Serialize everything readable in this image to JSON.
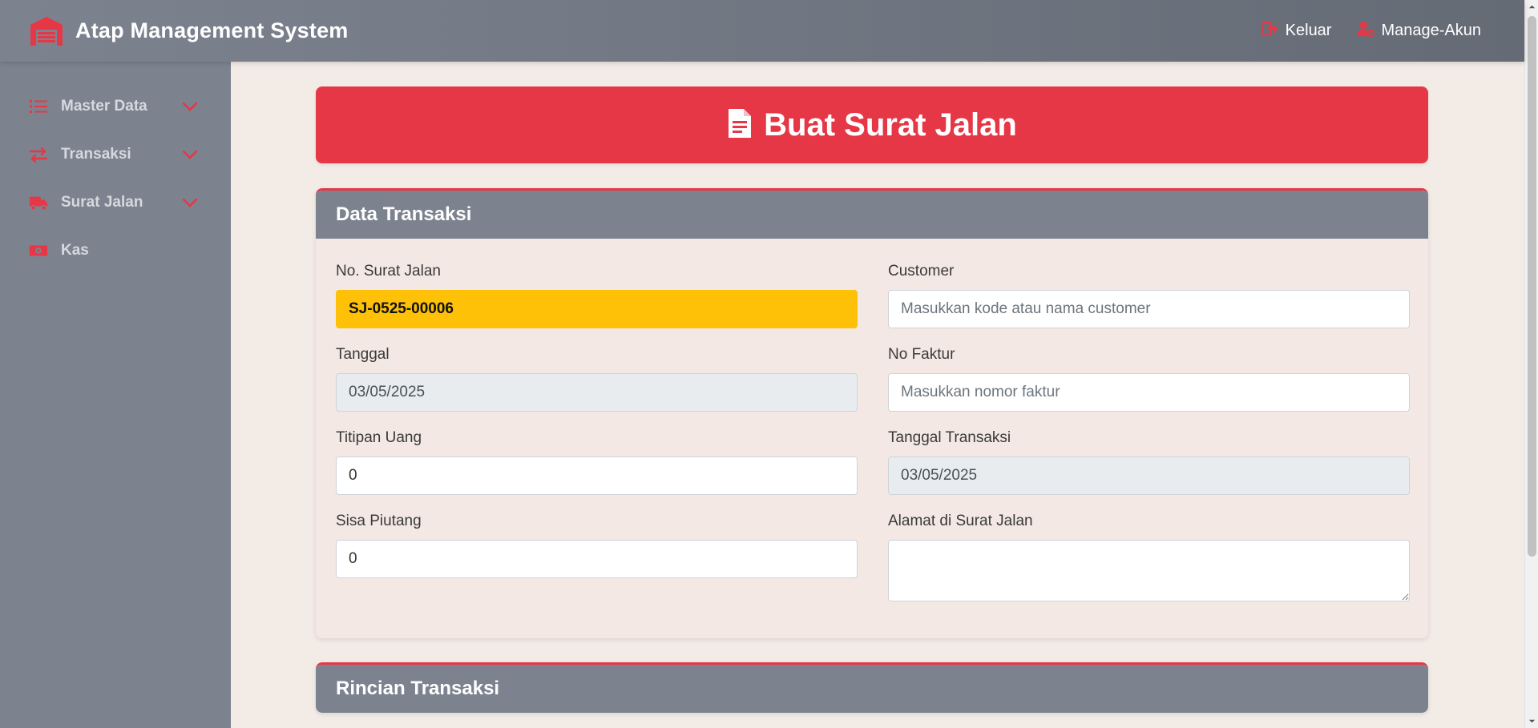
{
  "app": {
    "title": "Atap Management System"
  },
  "navbar": {
    "logout_label": "Keluar",
    "account_label": "Manage-Akun"
  },
  "sidebar": {
    "items": [
      {
        "label": "Master Data",
        "icon": "list-icon",
        "expandable": true
      },
      {
        "label": "Transaksi",
        "icon": "exchange-icon",
        "expandable": true
      },
      {
        "label": "Surat Jalan",
        "icon": "truck-icon",
        "expandable": true
      },
      {
        "label": "Kas",
        "icon": "money-icon",
        "expandable": false
      }
    ]
  },
  "page": {
    "title": "Buat Surat Jalan"
  },
  "data_transaksi": {
    "title": "Data Transaksi",
    "no_surat_jalan": {
      "label": "No. Surat Jalan",
      "value": "SJ-0525-00006"
    },
    "tanggal": {
      "label": "Tanggal",
      "value": "03/05/2025"
    },
    "titipan_uang": {
      "label": "Titipan Uang",
      "value": "0"
    },
    "sisa_piutang": {
      "label": "Sisa Piutang",
      "value": "0"
    },
    "customer": {
      "label": "Customer",
      "value": "",
      "placeholder": "Masukkan kode atau nama customer"
    },
    "no_faktur": {
      "label": "No Faktur",
      "value": "",
      "placeholder": "Masukkan nomor faktur"
    },
    "tanggal_transaksi": {
      "label": "Tanggal Transaksi",
      "value": "03/05/2025"
    },
    "alamat": {
      "label": "Alamat di Surat Jalan",
      "value": ""
    }
  },
  "rincian_transaksi": {
    "title": "Rincian Transaksi"
  },
  "colors": {
    "accent": "#e63746",
    "navbar": "#7c838f",
    "highlight": "#ffc107",
    "background": "#f3ebe6"
  }
}
